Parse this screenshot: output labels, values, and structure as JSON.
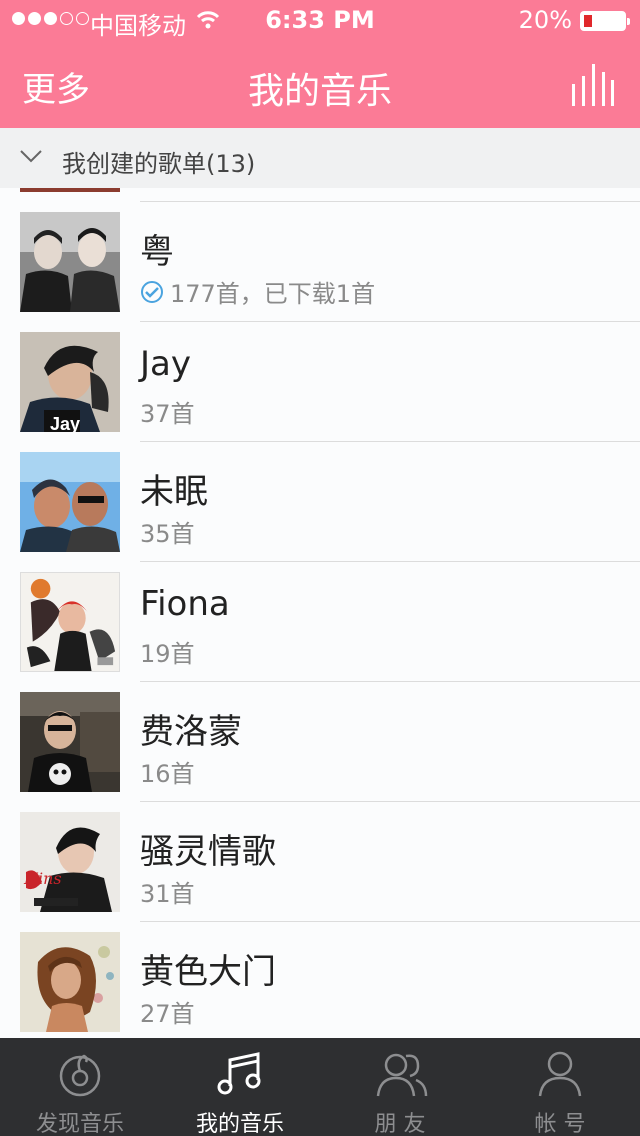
{
  "status": {
    "carrier": "中国移动",
    "time": "6:33 PM",
    "battery_text": "20%",
    "battery_level": 0.2
  },
  "nav": {
    "more_label": "更多",
    "title": "我的音乐"
  },
  "section": {
    "label": "我创建的歌单(13)"
  },
  "playlists": [
    {
      "title": "粤",
      "subtitle": "177首，已下载1首",
      "downloaded": true
    },
    {
      "title": "Jay",
      "subtitle": "37首"
    },
    {
      "title": "未眠",
      "subtitle": "35首"
    },
    {
      "title": "Fiona",
      "subtitle": "19首"
    },
    {
      "title": "费洛蒙",
      "subtitle": "16首"
    },
    {
      "title": "骚灵情歌",
      "subtitle": "31首"
    },
    {
      "title": "黄色大门",
      "subtitle": "27首"
    }
  ],
  "tabs": [
    {
      "label": "发现音乐",
      "icon": "discover-icon"
    },
    {
      "label": "我的音乐",
      "icon": "music-note-icon",
      "active": true
    },
    {
      "label": "朋 友",
      "icon": "friends-icon"
    },
    {
      "label": "帐 号",
      "icon": "account-icon"
    }
  ],
  "colors": {
    "accent": "#fb7b96",
    "tabbar": "#2e2f31",
    "check": "#4aa3df"
  }
}
